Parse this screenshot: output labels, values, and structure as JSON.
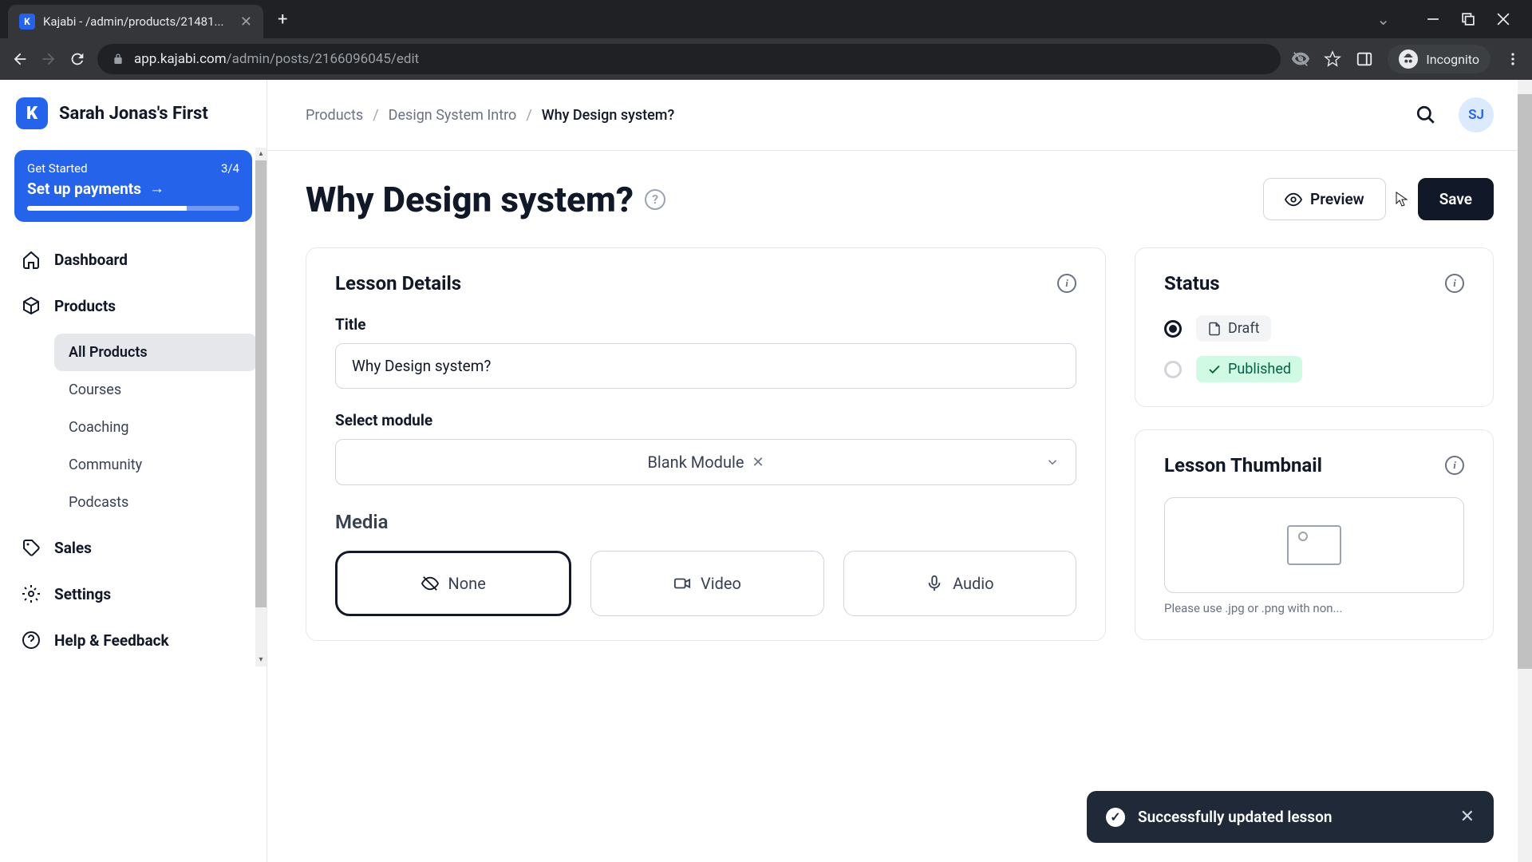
{
  "browser": {
    "tab_title": "Kajabi - /admin/products/21481...",
    "url_host": "app.kajabi.com",
    "url_path": "/admin/posts/2166096045/edit",
    "incognito_label": "Incognito"
  },
  "sidebar": {
    "brand_name": "Sarah Jonas's First",
    "get_started": {
      "label": "Get Started",
      "progress_text": "3/4",
      "action": "Set up payments"
    },
    "nav": {
      "dashboard": "Dashboard",
      "products": "Products",
      "sales": "Sales",
      "settings": "Settings",
      "help": "Help & Feedback"
    },
    "products_sub": {
      "all": "All Products",
      "courses": "Courses",
      "coaching": "Coaching",
      "community": "Community",
      "podcasts": "Podcasts"
    }
  },
  "breadcrumbs": {
    "products": "Products",
    "product": "Design System Intro",
    "current": "Why Design system?"
  },
  "avatar_initials": "SJ",
  "page": {
    "title": "Why Design system?",
    "preview_btn": "Preview",
    "save_btn": "Save"
  },
  "lesson_details": {
    "heading": "Lesson Details",
    "title_label": "Title",
    "title_value": "Why Design system?",
    "module_label": "Select module",
    "module_value": "Blank Module",
    "media_label": "Media",
    "media_none": "None",
    "media_video": "Video",
    "media_audio": "Audio"
  },
  "status": {
    "heading": "Status",
    "draft": "Draft",
    "published": "Published"
  },
  "thumbnail": {
    "heading": "Lesson Thumbnail",
    "hint": "Please use .jpg or .png with non..."
  },
  "toast": {
    "message": "Successfully updated lesson"
  }
}
